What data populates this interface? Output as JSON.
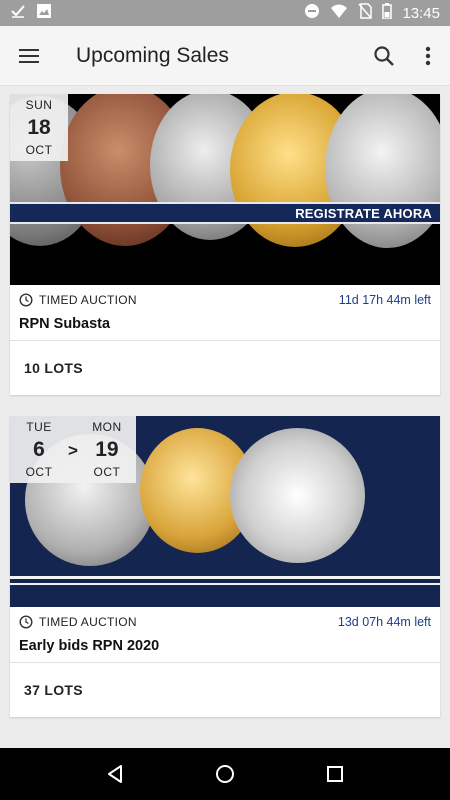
{
  "status": {
    "time": "13:45"
  },
  "app_bar": {
    "title": "Upcoming Sales"
  },
  "sales": [
    {
      "dates": [
        {
          "dow": "SUN",
          "day": "18",
          "month": "OCT"
        }
      ],
      "banner_text": "REGISTRATE AHORA",
      "auction_type": "TIMED AUCTION",
      "time_left": "11d 17h 44m left",
      "name": "RPN Subasta",
      "lots": "10 LOTS"
    },
    {
      "dates": [
        {
          "dow": "TUE",
          "day": "6",
          "month": "OCT"
        },
        {
          "dow": "MON",
          "day": "19",
          "month": "OCT"
        }
      ],
      "date_separator": ">",
      "auction_type": "TIMED AUCTION",
      "time_left": "13d 07h 44m left",
      "name": "Early bids RPN 2020",
      "lots": "37 LOTS"
    }
  ],
  "colors": {
    "status_bar": "#9e9e9e",
    "app_bar": "#f5f5f5",
    "accent_text": "#1f3f85",
    "banner_navy": "#14254f"
  },
  "icons": {
    "status_left": [
      "check-icon",
      "image-icon"
    ],
    "status_right": [
      "do-not-disturb-icon",
      "wifi-icon",
      "no-sim-icon",
      "battery-icon"
    ],
    "app_bar": [
      "menu-icon",
      "search-icon",
      "more-vert-icon"
    ],
    "nav": [
      "back-icon",
      "home-icon",
      "recents-icon"
    ]
  }
}
